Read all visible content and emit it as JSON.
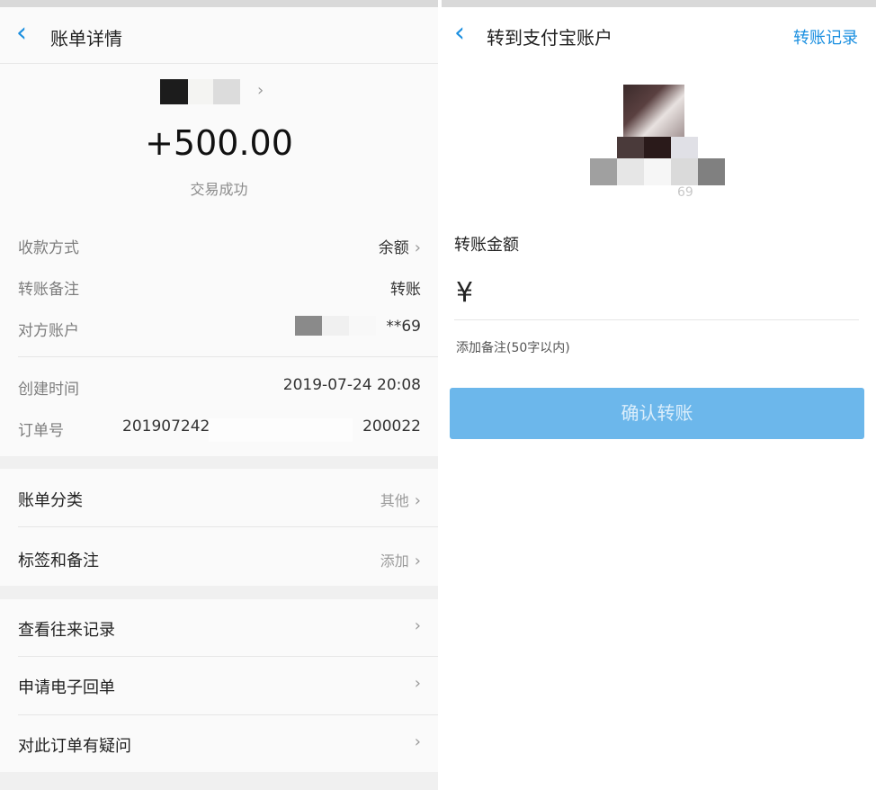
{
  "left": {
    "header": {
      "title": "账单详情"
    },
    "summary": {
      "amount": "+500.00",
      "status": "交易成功"
    },
    "details": [
      {
        "label": "收款方式",
        "value": "余额"
      },
      {
        "label": "转账备注",
        "value": "转账"
      },
      {
        "label": "对方账户",
        "value": "**69"
      }
    ],
    "meta": [
      {
        "label": "创建时间",
        "value": "2019-07-24 20:08"
      },
      {
        "label": "订单号",
        "value_start": "201907242",
        "value_end": "200022"
      }
    ],
    "category": [
      {
        "label": "账单分类",
        "value": "其他"
      },
      {
        "label": "标签和备注",
        "value": "添加"
      }
    ],
    "actions": [
      {
        "label": "查看往来记录"
      },
      {
        "label": "申请电子回单"
      },
      {
        "label": "对此订单有疑问"
      }
    ]
  },
  "right": {
    "header": {
      "title": "转到支付宝账户",
      "link": "转账记录"
    },
    "account_suffix": "69",
    "amount_label": "转账金额",
    "currency_symbol": "¥",
    "note_placeholder": "添加备注(50字以内)",
    "confirm_label": "确认转账"
  },
  "colors": {
    "accent": "#1a8fe0",
    "button": "#6cb7eb"
  }
}
